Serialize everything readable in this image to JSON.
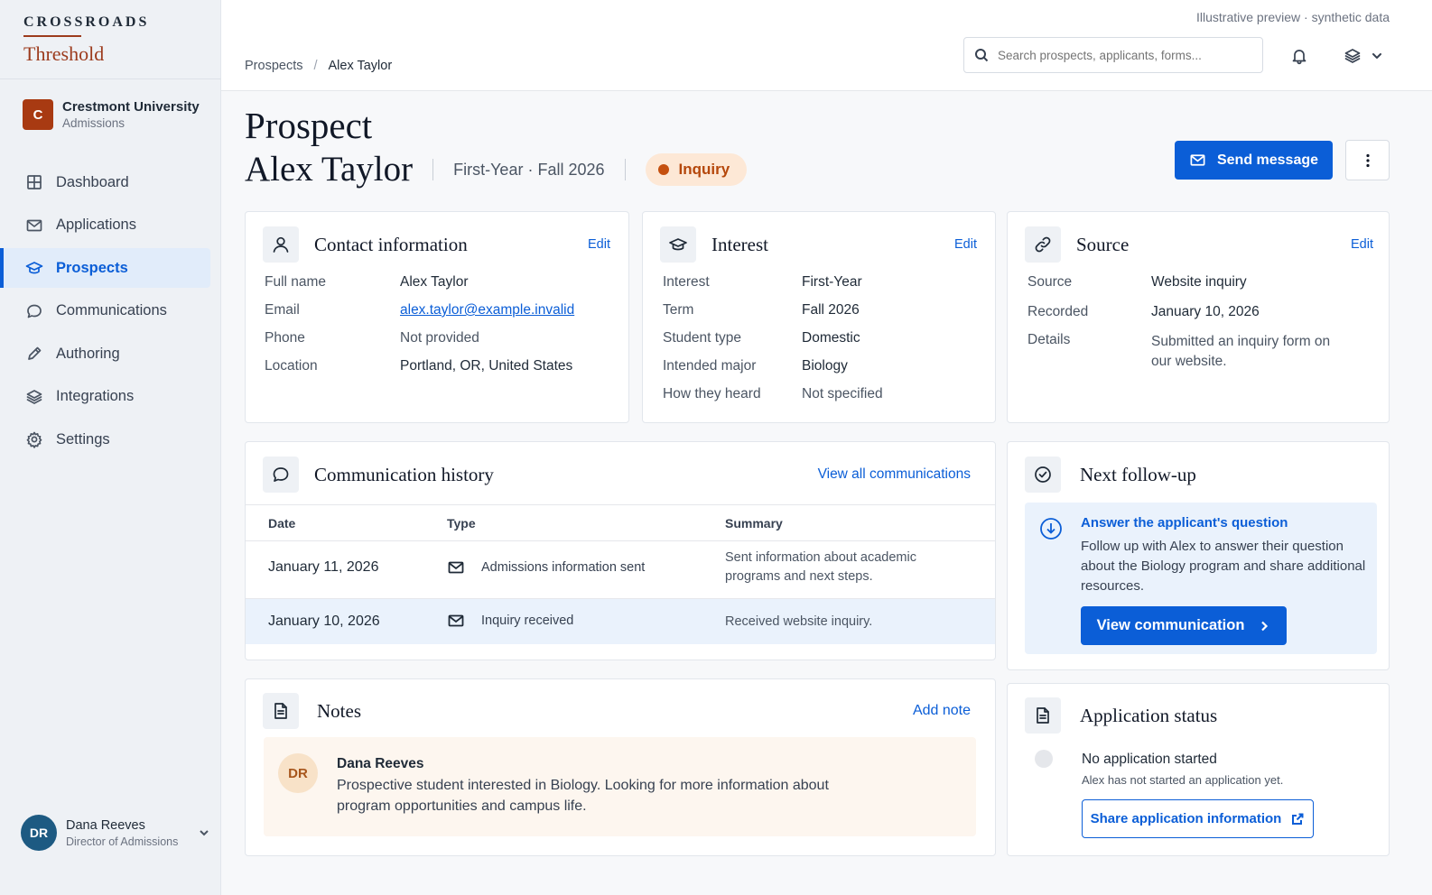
{
  "brand": {
    "top": "CROSSROADS",
    "name": "Threshold"
  },
  "org": {
    "initial": "C",
    "name": "Crestmont University",
    "sub": "Admissions"
  },
  "nav": [
    {
      "label": "Dashboard",
      "icon": "grid-icon"
    },
    {
      "label": "Applications",
      "icon": "mail-icon"
    },
    {
      "label": "Prospects",
      "icon": "graduation-cap-icon",
      "active": true
    },
    {
      "label": "Communications",
      "icon": "chat-bubble-icon"
    },
    {
      "label": "Authoring",
      "icon": "pencil-icon"
    },
    {
      "label": "Integrations",
      "icon": "layers-icon"
    },
    {
      "label": "Settings",
      "icon": "gear-icon"
    }
  ],
  "user": {
    "initials": "DR",
    "name": "Dana Reeves",
    "role": "Director of Admissions"
  },
  "topbar": {
    "preview_note": "Illustrative preview · synthetic data",
    "search_placeholder": "Search prospects, applicants, forms...",
    "breadcrumb": [
      "Prospects",
      "Alex Taylor"
    ]
  },
  "header": {
    "kicker": "Prospect",
    "name": "Alex Taylor",
    "term": "First-Year · Fall 2026",
    "status": "Inquiry",
    "send_label": "Send message"
  },
  "contact": {
    "title": "Contact information",
    "action": "Edit",
    "rows": [
      {
        "k": "Full name",
        "v": "Alex Taylor"
      },
      {
        "k": "Email",
        "v": "alex.taylor@example.invalid"
      },
      {
        "k": "Phone",
        "v": "Not provided"
      },
      {
        "k": "Location",
        "v": "Portland, OR, United States"
      }
    ]
  },
  "interest": {
    "title": "Interest",
    "action": "Edit",
    "rows": [
      {
        "k": "Interest",
        "v": "First-Year"
      },
      {
        "k": "Term",
        "v": "Fall 2026"
      },
      {
        "k": "Student type",
        "v": "Domestic"
      },
      {
        "k": "Intended major",
        "v": "Biology"
      },
      {
        "k": "How they heard",
        "v": "Not specified"
      }
    ]
  },
  "source": {
    "title": "Source",
    "action": "Edit",
    "rows": [
      {
        "k": "Source",
        "v": "Website inquiry"
      },
      {
        "k": "Recorded",
        "v": "January 10, 2026"
      },
      {
        "k": "Details",
        "v": "Submitted an inquiry form on our website."
      }
    ]
  },
  "comms": {
    "title": "Communication history",
    "action": "View all communications",
    "headers": [
      "Date",
      "Type",
      "Summary"
    ],
    "rows": [
      {
        "date": "January 11, 2026",
        "type": "Admissions information sent",
        "summary": "Sent information about academic programs and next steps."
      },
      {
        "date": "January 10, 2026",
        "type": "Inquiry received",
        "summary": "Received website inquiry."
      }
    ]
  },
  "followup": {
    "title": "Next follow-up",
    "task_title": "Answer the applicant's question",
    "task_text": "Follow up with Alex to answer their question about the Biology program and share additional resources.",
    "button": "View communication"
  },
  "notes": {
    "title": "Notes",
    "action": "Add note",
    "author_initials": "DR",
    "author": "Dana Reeves",
    "text": "Prospective student interested in Biology. Looking for more information about program opportunities and campus life."
  },
  "app_status": {
    "title": "Application status",
    "status": "No application started",
    "sub": "Alex has not started an application yet.",
    "button": "Share application information"
  }
}
